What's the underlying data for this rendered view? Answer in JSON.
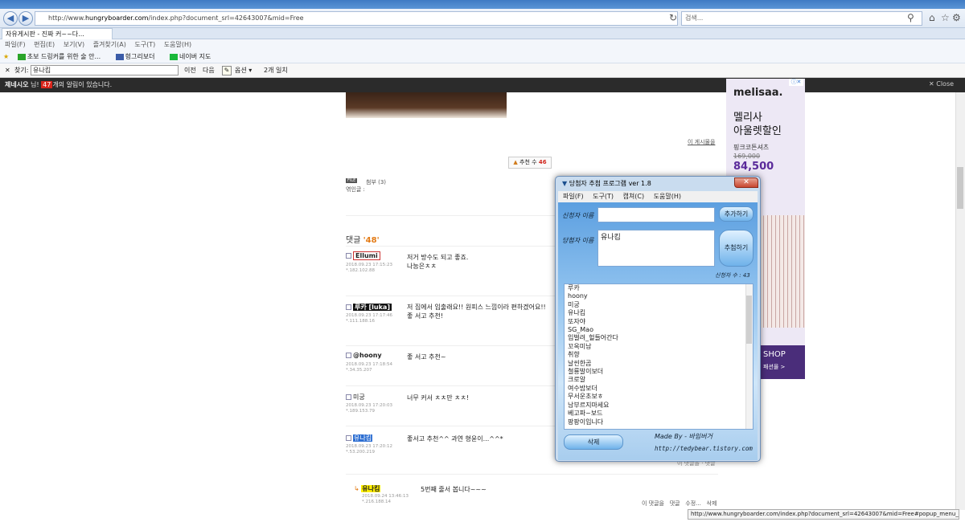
{
  "browser": {
    "url_pre": "http://www.",
    "url_domain": "hungryboarder.com",
    "url_post": "/index.php?document_srl=42643007&mid=Free",
    "search_placeholder": "검색...",
    "tab_title": "자유게시판 - 진짜 커~~다...",
    "menu": [
      "파일(F)",
      "편집(E)",
      "보기(V)",
      "즐겨찾기(A)",
      "도구(T)",
      "도움말(H)"
    ],
    "favorites": [
      "초보 드링커를 위한 술 안...",
      "헝그리보더",
      "네이버 지도"
    ],
    "find": {
      "label": "찾기:",
      "value": "유나킴",
      "prev": "이전",
      "next": "다음",
      "options": "옵션",
      "matches": "2개 일치"
    },
    "notification": {
      "user": "제네시오",
      "suffix": "님!",
      "count": "47",
      "message": "개의 알림이 있습니다.",
      "close": "Close"
    },
    "status_url": "http://www.hungryboarder.com/index.php?document_srl=42643007&mid=Free#popup_menu_area"
  },
  "post": {
    "list_link": "이 게시물을",
    "recommend_label": "추천 수",
    "recommend_count": "46",
    "file_badge": "FILE",
    "attach": "첨부 (3)",
    "source": "엮인글 :",
    "comments_label": "댓글",
    "comments_count": "'48'"
  },
  "comments": [
    {
      "nick": "Ellumi",
      "date": "2018.09.23 17:15:23",
      "ip": "*.182.102.88",
      "text1": "저거 방수도 되고 좋죠.",
      "text2": "나눔은ㅊㅊ"
    },
    {
      "nick": "루카 [luka]",
      "date": "2018.09.23 17:17:46",
      "ip": "*.111.188.16",
      "text1": "저 집에서 입출래요!! 원피스 느낌이라 편하겠어요!!",
      "text2": "좋 서고 추천!"
    },
    {
      "nick": "@hoony",
      "date": "2018.09.23 17:18:54",
      "ip": "*.34.35.207",
      "text1": "좋 서고 추천~",
      "text2": ""
    },
    {
      "nick": "미궁",
      "date": "2018.09.23 17:20:03",
      "ip": "*.189.153.79",
      "text1": "너무 커서 ㅊㅊ만 ㅊㅊ!",
      "text2": ""
    },
    {
      "nick": "유나킴",
      "date": "2018.09.23 17:20:12",
      "ip": "*.53.200.219",
      "text1": "좋서고 추천^^ 과연 형윤이...^^*",
      "text2": ""
    }
  ],
  "reply": {
    "nick": "유나킴",
    "date": "2018.09.24 13:46:13",
    "ip": "*.216.188.14",
    "text": "5번째 줄서 봅니다~~~",
    "ctrl": [
      "이 댓글을",
      "댓글",
      "수정...",
      "삭제"
    ]
  },
  "faded_ctrl": "이 댓글을 · 댓글",
  "ad": {
    "brand": "melisaa.",
    "headline1": "멜리사",
    "headline2": "아울렛할인",
    "sub": "핑크코튼셔츠",
    "old_price": "169,000",
    "price": "84,500",
    "shop": "SHOP",
    "shop_sub": "패션몰 >"
  },
  "dialog": {
    "title": "당첨자 추첨 프로그램 ver 1.8",
    "menu": [
      "파일(F)",
      "도구(T)",
      "캡쳐(C)",
      "도움말(H)"
    ],
    "entrant_label": "신청자 이름",
    "winner_label": "당첨자 이름",
    "entrant_value": "",
    "winner_value": "유나킴",
    "add_button": "추가하기",
    "draw_button": "추첨하기",
    "count_label": "신청자 수 : 43",
    "delete_button": "삭제",
    "credit1": "Made By - 바임버거",
    "credit2": "http://tedybear.tistory.com",
    "entrants": [
      "루카",
      "hoony",
      "미궁",
      "유나킴",
      "또자야",
      "SG_Mao",
      "입벌려_헐들어간다",
      "꼬옥미남",
      "취향",
      "날씬한곰",
      "철룡발이보더",
      "크로알",
      "여수밤보더",
      "무서운초보ㅎ",
      "남부르지마세요",
      "베고파~보드",
      "팡팡이입니다"
    ]
  }
}
